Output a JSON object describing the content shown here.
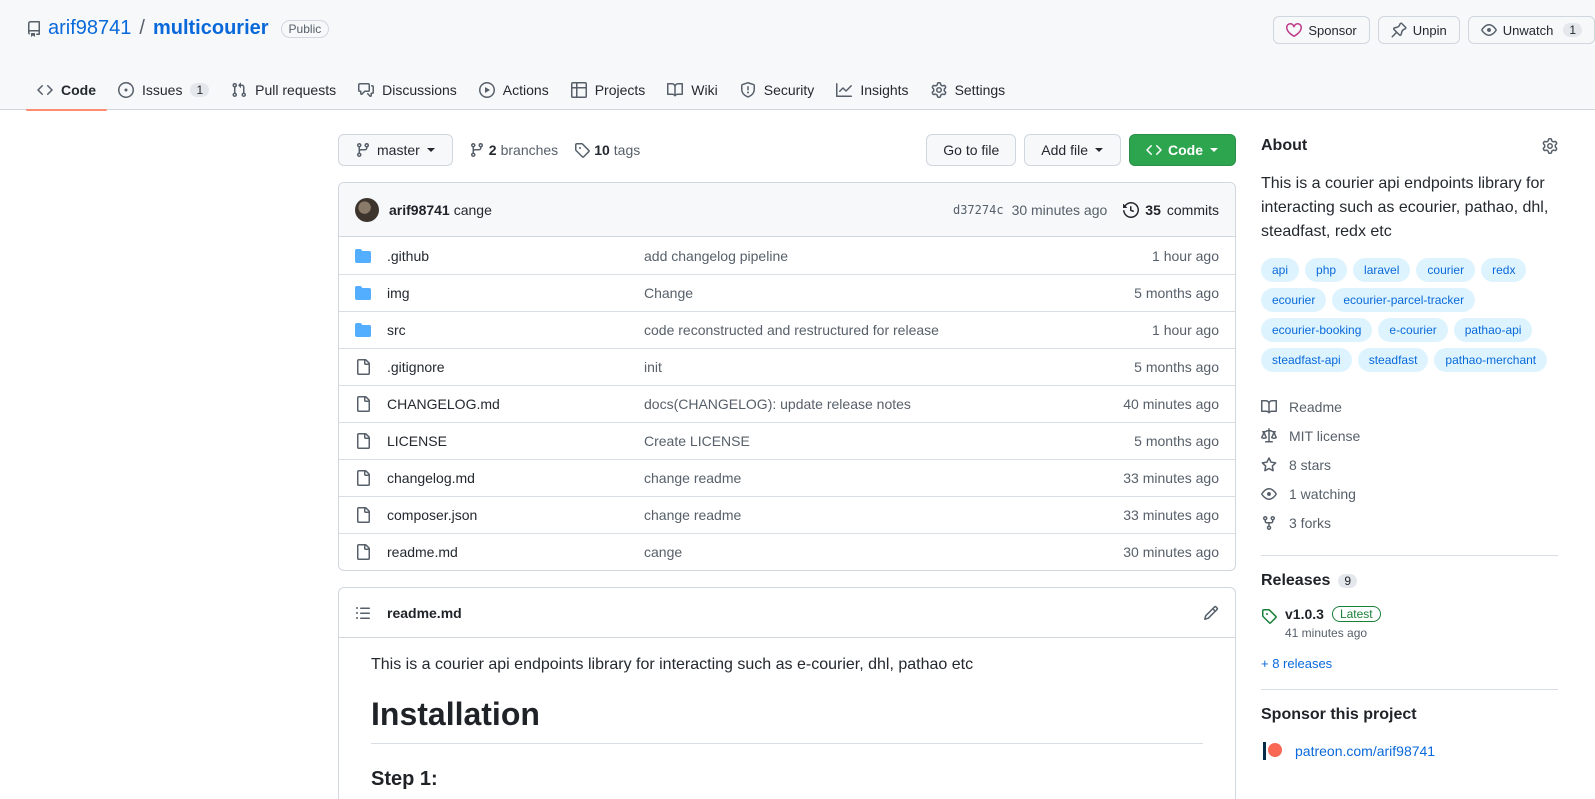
{
  "repo": {
    "owner": "arif98741",
    "slash": "/",
    "name": "multicourier",
    "visibility": "Public"
  },
  "header_actions": {
    "sponsor": "Sponsor",
    "unpin": "Unpin",
    "unwatch": "Unwatch",
    "watch_count": "1"
  },
  "tabs": [
    {
      "label": "Code",
      "icon": "code-icon"
    },
    {
      "label": "Issues",
      "icon": "issue-icon",
      "count": "1"
    },
    {
      "label": "Pull requests",
      "icon": "pull-request-icon"
    },
    {
      "label": "Discussions",
      "icon": "discussion-icon"
    },
    {
      "label": "Actions",
      "icon": "play-icon"
    },
    {
      "label": "Projects",
      "icon": "table-icon"
    },
    {
      "label": "Wiki",
      "icon": "book-icon"
    },
    {
      "label": "Security",
      "icon": "shield-icon"
    },
    {
      "label": "Insights",
      "icon": "graph-icon"
    },
    {
      "label": "Settings",
      "icon": "gear-icon"
    }
  ],
  "toolbar": {
    "branch": "master",
    "branches_count": "2",
    "branches_label": "branches",
    "tags_count": "10",
    "tags_label": "tags",
    "go_to_file": "Go to file",
    "add_file": "Add file",
    "code": "Code"
  },
  "latest_commit": {
    "author": "arif98741",
    "message": "cange",
    "sha": "d37274c",
    "time": "30 minutes ago",
    "commits_count": "35",
    "commits_label": "commits"
  },
  "files": [
    {
      "type": "dir",
      "name": ".github",
      "message": "add changelog pipeline",
      "time": "1 hour ago"
    },
    {
      "type": "dir",
      "name": "img",
      "message": "Change",
      "time": "5 months ago"
    },
    {
      "type": "dir",
      "name": "src",
      "message": "code reconstructed and restructured for release",
      "time": "1 hour ago"
    },
    {
      "type": "file",
      "name": ".gitignore",
      "message": "init",
      "time": "5 months ago"
    },
    {
      "type": "file",
      "name": "CHANGELOG.md",
      "message": "docs(CHANGELOG): update release notes",
      "time": "40 minutes ago"
    },
    {
      "type": "file",
      "name": "LICENSE",
      "message": "Create LICENSE",
      "time": "5 months ago"
    },
    {
      "type": "file",
      "name": "changelog.md",
      "message": "change readme",
      "time": "33 minutes ago"
    },
    {
      "type": "file",
      "name": "composer.json",
      "message": "change readme",
      "time": "33 minutes ago"
    },
    {
      "type": "file",
      "name": "readme.md",
      "message": "cange",
      "time": "30 minutes ago"
    }
  ],
  "readme": {
    "filename": "readme.md",
    "intro": "This is a courier api endpoints library for interacting such as e-courier, dhl, pathao etc",
    "h1": "Installation",
    "h3": "Step 1:"
  },
  "about": {
    "title": "About",
    "description": "This is a courier api endpoints library for interacting such as ecourier, pathao, dhl, steadfast, redx etc",
    "topics": [
      "api",
      "php",
      "laravel",
      "courier",
      "redx",
      "ecourier",
      "ecourier-parcel-tracker",
      "ecourier-booking",
      "e-courier",
      "pathao-api",
      "steadfast-api",
      "steadfast",
      "pathao-merchant"
    ],
    "items": [
      {
        "icon": "book-icon",
        "label": "Readme"
      },
      {
        "icon": "law-icon",
        "label": "MIT license"
      },
      {
        "icon": "star-icon",
        "label": "8 stars"
      },
      {
        "icon": "eye-icon",
        "label": "1 watching"
      },
      {
        "icon": "fork-icon",
        "label": "3 forks"
      }
    ]
  },
  "releases": {
    "title": "Releases",
    "count": "9",
    "latest_version": "v1.0.3",
    "latest_badge": "Latest",
    "latest_time": "41 minutes ago",
    "more": "+ 8 releases"
  },
  "sponsor": {
    "title": "Sponsor this project",
    "link": "patreon.com/arif98741"
  },
  "colors": {
    "accent": "#0969da",
    "green": "#2da44e",
    "tab_underline": "#fd8c73",
    "folder": "#54aeff"
  }
}
